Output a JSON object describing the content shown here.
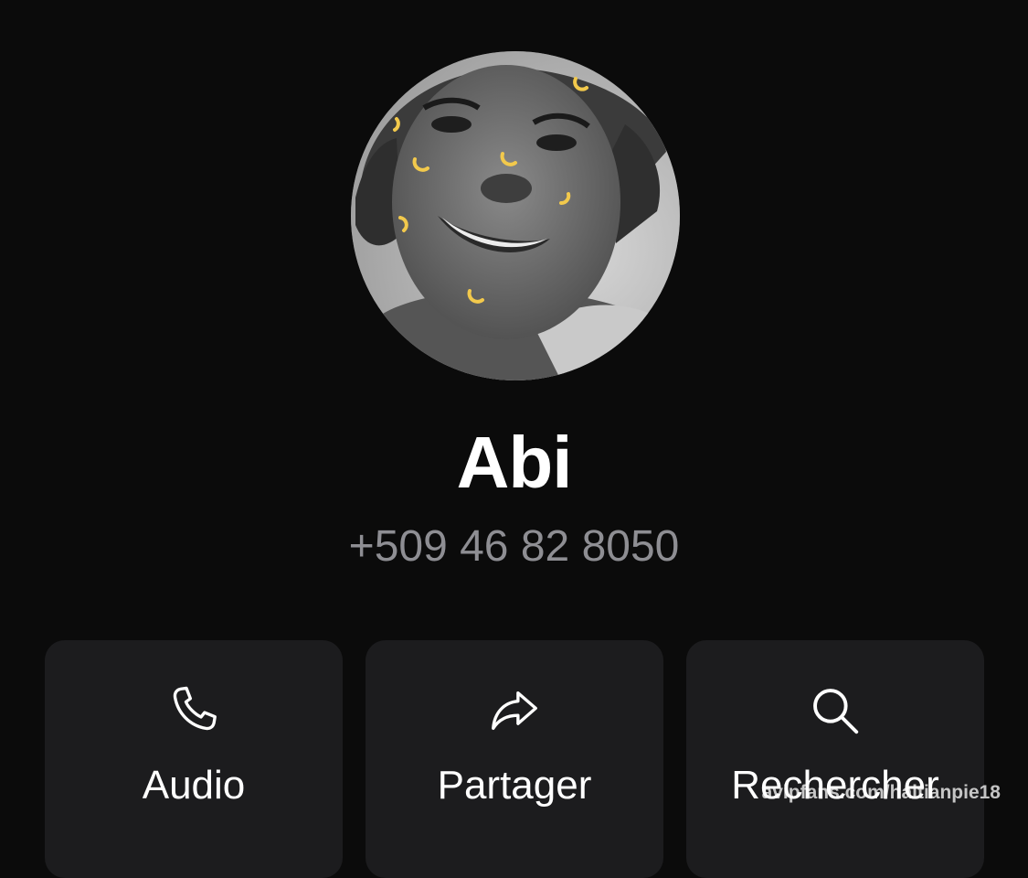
{
  "contact": {
    "name": "Abi",
    "phone": "+509 46 82 8050",
    "avatar_icon": "profile-photo"
  },
  "actions": [
    {
      "label": "Audio",
      "icon": "phone-icon"
    },
    {
      "label": "Partager",
      "icon": "share-arrow-icon"
    },
    {
      "label": "Rechercher",
      "icon": "search-icon"
    }
  ],
  "watermark": "avipfans.com/haitianpie18",
  "colors": {
    "background": "#0b0b0b",
    "card": "#1c1c1e",
    "secondary_text": "#8e8e93",
    "sticker_accent": "#f2c94c"
  }
}
